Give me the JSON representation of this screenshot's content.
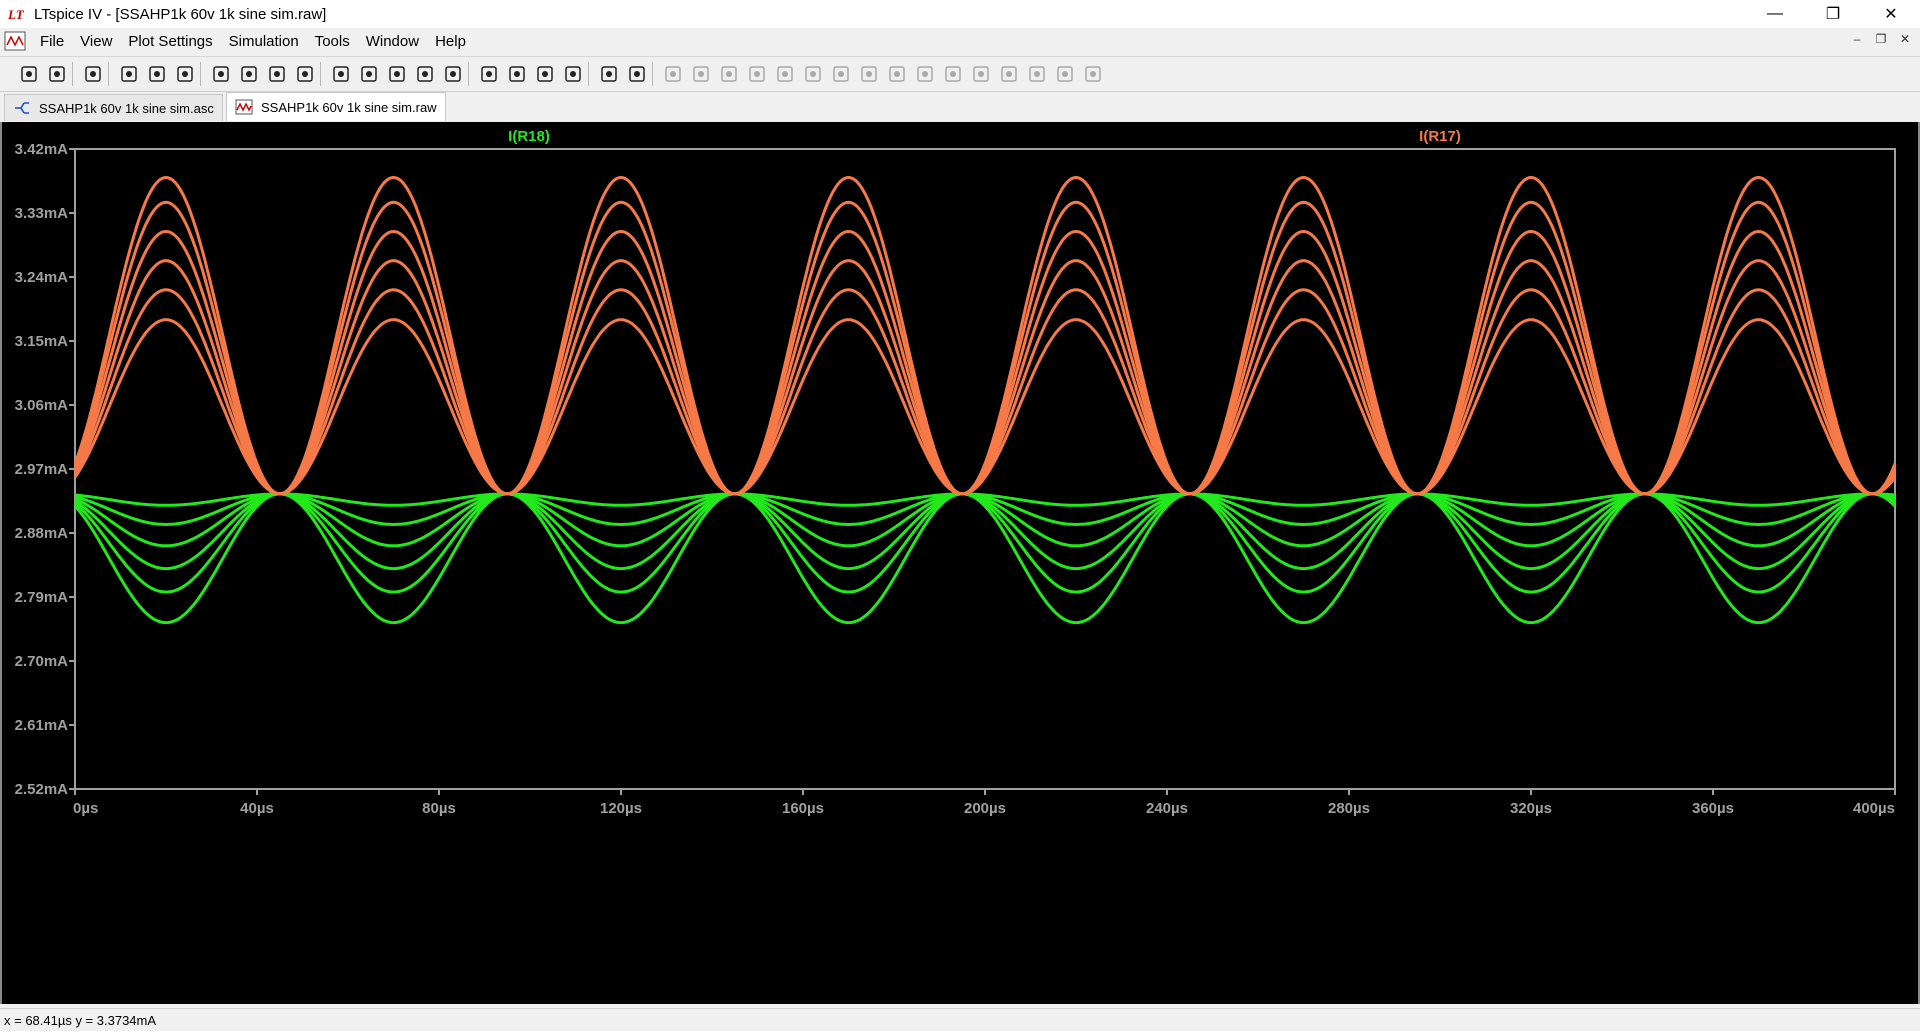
{
  "window": {
    "title": "LTspice IV - [SSAHP1k 60v 1k sine sim.raw]",
    "controls": {
      "minimize": "—",
      "restore": "❐",
      "close": "✕"
    }
  },
  "menu": {
    "items": [
      "File",
      "View",
      "Plot Settings",
      "Simulation",
      "Tools",
      "Window",
      "Help"
    ]
  },
  "mdi_controls": {
    "minimize": "–",
    "restore": "❐",
    "close": "✕"
  },
  "toolbar": {
    "icons": [
      "new-schematic-icon",
      "open-icon",
      "save-icon",
      "control-panel-icon",
      "run-icon",
      "halt-icon",
      "zoom-in-icon",
      "zoom-out-icon",
      "zoom-full-icon",
      "zoom-cancel-icon",
      "autorange-icon",
      "mark-icon",
      "tile-horizontal-icon",
      "cascade-icon",
      "tile-vertical-icon",
      "cut-icon",
      "copy-icon",
      "paste-icon",
      "find-icon",
      "print-setup-icon",
      "print-icon",
      "wire-icon",
      "ground-icon",
      "label-icon",
      "resistor-icon",
      "capacitor-icon",
      "inductor-icon",
      "diode-icon",
      "component-icon",
      "move-icon",
      "drag-icon",
      "undo-icon",
      "redo-icon",
      "rotate-icon",
      "mirror-icon",
      "text-icon",
      "spice-directive-icon"
    ]
  },
  "tabs": [
    {
      "label": "SSAHP1k 60v 1k sine sim.asc",
      "icon": "schematic-icon",
      "active": false
    },
    {
      "label": "SSAHP1k 60v 1k sine sim.raw",
      "icon": "waveform-icon",
      "active": true
    }
  ],
  "status": {
    "text": "x = 68.41µs    y = 3.3734mA"
  },
  "colors": {
    "background": "#000000",
    "grid": "#a0a0a0",
    "trace_r18": "#22e81c",
    "trace_r17": "#f57a48"
  },
  "chart_data": {
    "type": "line",
    "title": "",
    "xlabel": "",
    "ylabel": "",
    "xlim": [
      0,
      400
    ],
    "ylim": [
      2.52,
      3.42
    ],
    "x_unit": "µs",
    "y_unit": "mA",
    "x_ticks": [
      "0µs",
      "40µs",
      "80µs",
      "120µs",
      "160µs",
      "200µs",
      "240µs",
      "280µs",
      "320µs",
      "360µs",
      "400µs"
    ],
    "x_tick_values": [
      0,
      40,
      80,
      120,
      160,
      200,
      240,
      280,
      320,
      360,
      400
    ],
    "y_ticks": [
      "3.42mA",
      "3.33mA",
      "3.24mA",
      "3.15mA",
      "3.06mA",
      "2.97mA",
      "2.88mA",
      "2.79mA",
      "2.70mA",
      "2.61mA",
      "2.52mA"
    ],
    "y_tick_values": [
      3.42,
      3.33,
      3.24,
      3.15,
      3.06,
      2.97,
      2.88,
      2.79,
      2.7,
      2.61,
      2.52
    ],
    "frequency_khz": 20,
    "grid": false,
    "legend": "top",
    "series": [
      {
        "name": "I(R18)",
        "color": "#22e81c",
        "pinch": 2.935,
        "tails": [
          2.754,
          2.797,
          2.83,
          2.862,
          2.892,
          2.919
        ]
      },
      {
        "name": "I(R17)",
        "color": "#f57a48",
        "pinch": 2.935,
        "tails": [
          3.18,
          3.222,
          3.263,
          3.304,
          3.345,
          3.38
        ]
      }
    ]
  }
}
